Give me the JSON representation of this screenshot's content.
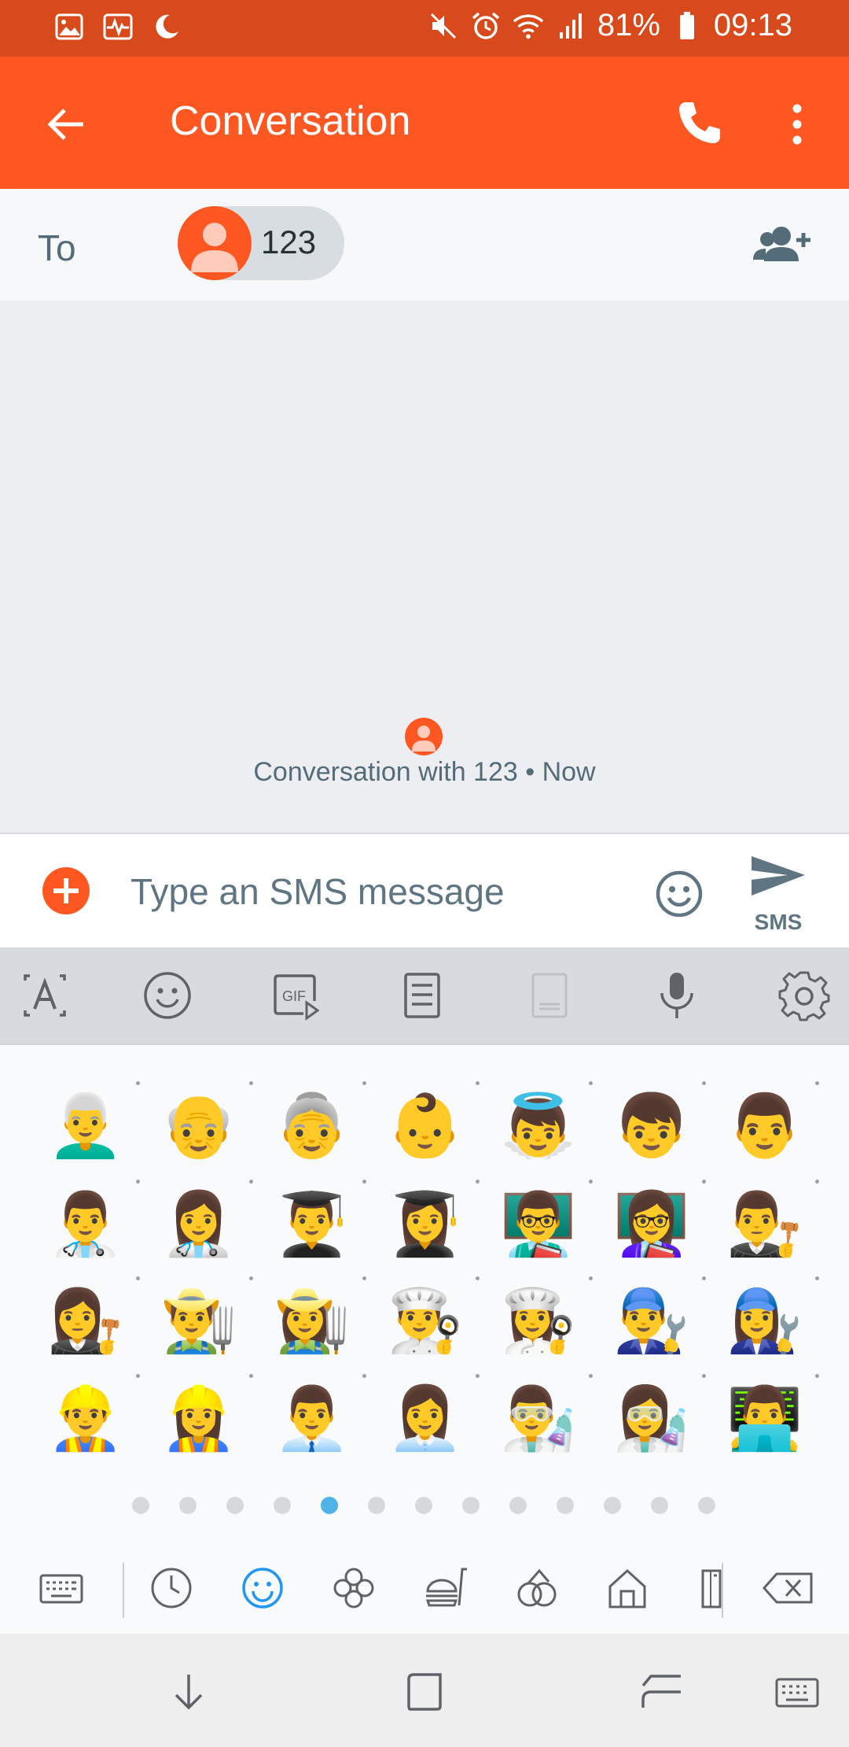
{
  "status_bar": {
    "battery": "81%",
    "time": "09:13",
    "left_icons": [
      "gallery-icon",
      "health-icon",
      "moon-icon"
    ],
    "right_icons": [
      "mute-icon",
      "alarm-icon",
      "wifi-icon",
      "signal-icon",
      "battery-icon"
    ]
  },
  "toolbar": {
    "title": "Conversation",
    "back_icon": "arrow-back-icon",
    "call_icon": "phone-icon",
    "more_icon": "more-vert-icon",
    "color": "#ff5722"
  },
  "recipients": {
    "to_label": "To",
    "chips": [
      {
        "name": "123"
      }
    ],
    "add_icon": "add-contact-icon"
  },
  "conversation": {
    "info": "Conversation with 123 • Now"
  },
  "composer": {
    "placeholder": "Type an SMS message",
    "value": "",
    "send_label": "SMS"
  },
  "keyboard": {
    "toolbar_icons": [
      "text-mode-icon",
      "emoji-icon",
      "gif-icon",
      "clipboard-icon",
      "one-handed-keyboard-icon",
      "microphone-icon",
      "settings-icon"
    ],
    "emoji_rows": [
      [
        "👨‍🦳",
        "👴",
        "👵",
        "👶",
        "👼",
        "👦",
        "👨"
      ],
      [
        "👨‍⚕️",
        "👩‍⚕️",
        "👨‍🎓",
        "👩‍🎓",
        "👨‍🏫",
        "👩‍🏫",
        "👨‍⚖️"
      ],
      [
        "👩‍⚖️",
        "👨‍🌾",
        "👩‍🌾",
        "👨‍🍳",
        "👩‍🍳",
        "👨‍🔧",
        "👩‍🔧"
      ],
      [
        "👷‍♂️",
        "👷‍♀️",
        "👨‍💼",
        "👩‍💼",
        "👨‍🔬",
        "👩‍🔬",
        "👨‍💻"
      ]
    ],
    "page_count": 13,
    "active_page": 5,
    "categories": [
      "keyboard-icon",
      "recent-icon",
      "smileys-icon",
      "nature-icon",
      "food-icon",
      "activity-icon",
      "places-icon",
      "objects-icon",
      "backspace-icon"
    ],
    "active_category": "smileys-icon",
    "accent": "#4fb3e8"
  },
  "nav_bar": {
    "icons": [
      "hide-keyboard-icon",
      "recents-icon",
      "back-icon",
      "switch-keyboard-icon"
    ]
  }
}
